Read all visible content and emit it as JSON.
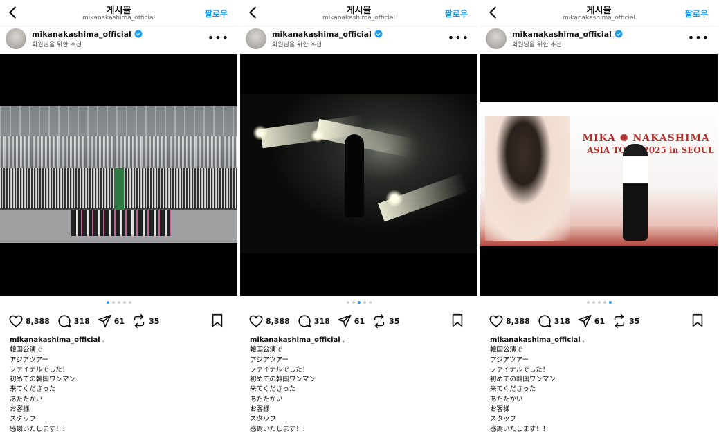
{
  "posts": [
    {
      "header": {
        "title": "게시물",
        "subtitle": "mikanakashima_official",
        "follow": "팔로우"
      },
      "author": {
        "username": "mikanakashima_official",
        "suggestion": "회원님을 위한 추천"
      },
      "carousel": {
        "count": 5,
        "active": 0
      },
      "actions": {
        "likes": "8,388",
        "comments": "318",
        "shares": "61",
        "reposts": "35"
      },
      "caption": {
        "username": "mikanakashima_official",
        "lines": [
          "韓国公演で",
          "アジアツアー",
          "ファイナルでした！",
          "初めての韓国ワンマン",
          "来てくださった",
          "あたたかい",
          "お客様",
          "スタッフ",
          "感謝いたします！！"
        ]
      }
    },
    {
      "header": {
        "title": "게시물",
        "subtitle": "mikanakashima_official",
        "follow": "팔로우"
      },
      "author": {
        "username": "mikanakashima_official",
        "suggestion": "회원님을 위한 추천"
      },
      "carousel": {
        "count": 5,
        "active": 2
      },
      "actions": {
        "likes": "8,388",
        "comments": "318",
        "shares": "61",
        "reposts": "35"
      },
      "caption": {
        "username": "mikanakashima_official",
        "lines": [
          "韓国公演で",
          "アジアツアー",
          "ファイナルでした！",
          "初めての韓国ワンマン",
          "来てくださった",
          "あたたかい",
          "お客様",
          "スタッフ",
          "感謝いたします！！"
        ]
      }
    },
    {
      "header": {
        "title": "게시물",
        "subtitle": "mikanakashima_official",
        "follow": "팔로우"
      },
      "author": {
        "username": "mikanakashima_official",
        "suggestion": "회원님을 위한 추천"
      },
      "carousel": {
        "count": 5,
        "active": 4
      },
      "banner": {
        "line1": "MIKA ✺ NAKASHIMA",
        "line2": "ASIA TOUR 2025 in SEOUL"
      },
      "actions": {
        "likes": "8,388",
        "comments": "318",
        "shares": "61",
        "reposts": "35"
      },
      "caption": {
        "username": "mikanakashima_official",
        "lines": [
          "韓国公演で",
          "アジアツアー",
          "ファイナルでした！",
          "初めての韓国ワンマン",
          "来てくださった",
          "あたたかい",
          "お客様",
          "スタッフ",
          "感謝いたします！！"
        ]
      }
    }
  ],
  "colors": {
    "accent": "#1e9cf0",
    "text": "#111111",
    "media_bg": "#000000"
  }
}
